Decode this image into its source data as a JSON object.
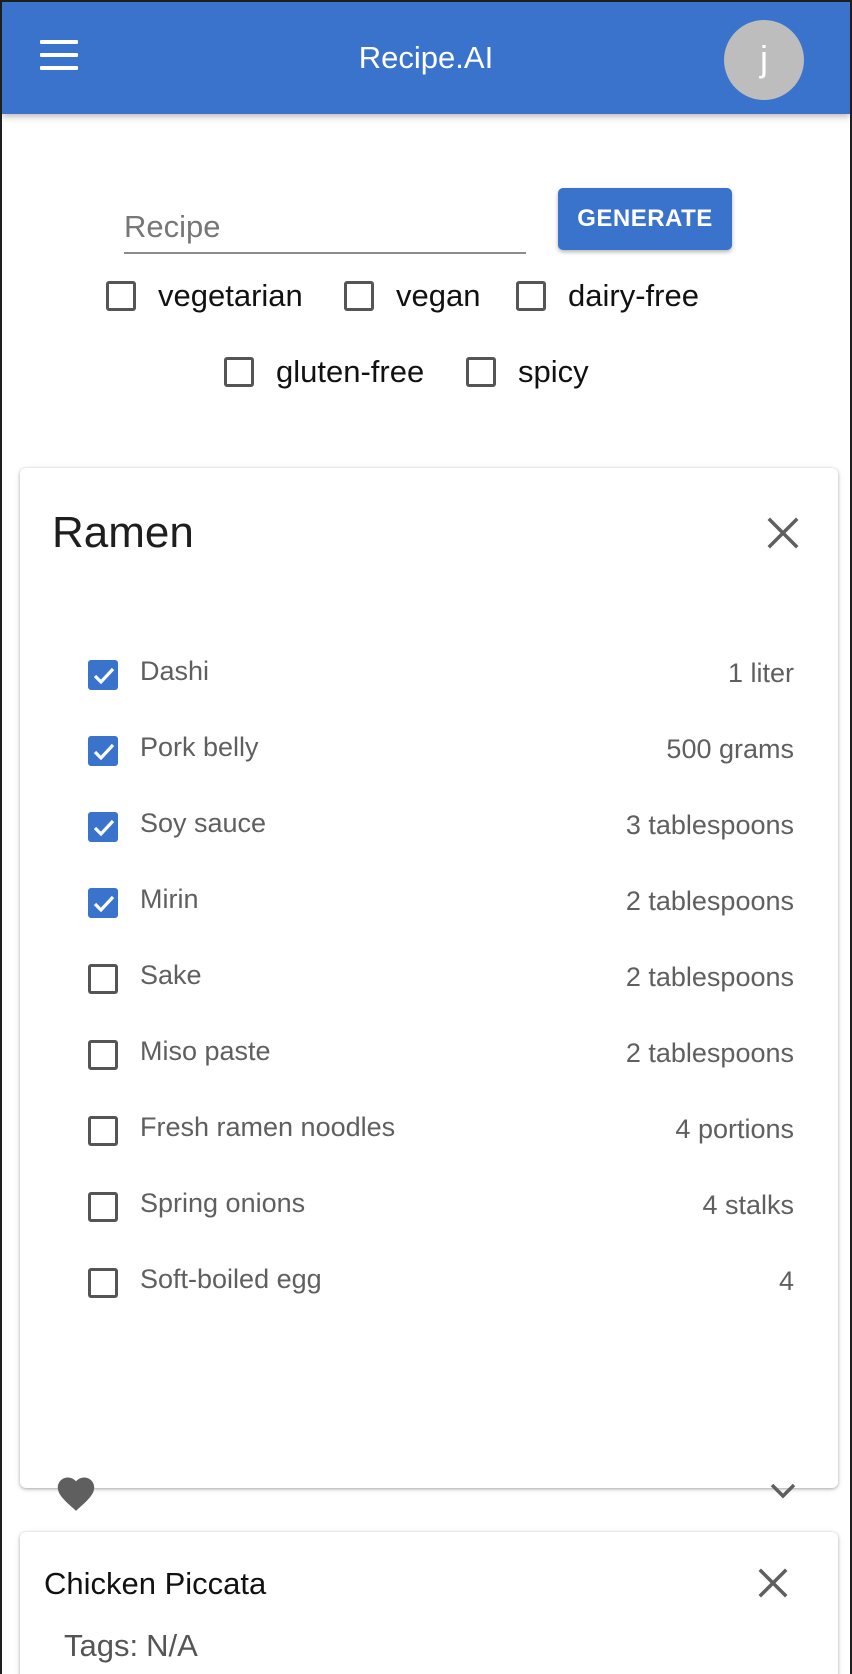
{
  "appbar": {
    "title": "Recipe.AI",
    "avatar_letter": "j",
    "color": "#3a73cc"
  },
  "search": {
    "placeholder": "Recipe",
    "value": "",
    "generate_label": "GENERATE"
  },
  "filters": [
    {
      "label": "vegetarian",
      "checked": false
    },
    {
      "label": "vegan",
      "checked": false
    },
    {
      "label": "dairy-free",
      "checked": false
    },
    {
      "label": "gluten-free",
      "checked": false
    },
    {
      "label": "spicy",
      "checked": false
    }
  ],
  "recipes": [
    {
      "title": "Ramen",
      "favorite": true,
      "ingredients": [
        {
          "name": "Dashi",
          "quantity": "1 liter",
          "checked": true
        },
        {
          "name": "Pork belly",
          "quantity": "500 grams",
          "checked": true
        },
        {
          "name": "Soy sauce",
          "quantity": "3 tablespoons",
          "checked": true
        },
        {
          "name": "Mirin",
          "quantity": "2 tablespoons",
          "checked": true
        },
        {
          "name": "Sake",
          "quantity": "2 tablespoons",
          "checked": false
        },
        {
          "name": "Miso paste",
          "quantity": "2 tablespoons",
          "checked": false
        },
        {
          "name": "Fresh ramen noodles",
          "quantity": "4 portions",
          "checked": false
        },
        {
          "name": "Spring onions",
          "quantity": "4 stalks",
          "checked": false
        },
        {
          "name": "Soft-boiled egg",
          "quantity": "4",
          "checked": false
        }
      ]
    },
    {
      "title": "Chicken Piccata",
      "tags_label": "Tags:",
      "tags_value": "N/A"
    }
  ],
  "icons": {
    "menu": "hamburger-icon",
    "close": "close-icon",
    "check": "checkmark-icon",
    "favorite": "heart-icon",
    "expand": "chevron-down-icon"
  }
}
